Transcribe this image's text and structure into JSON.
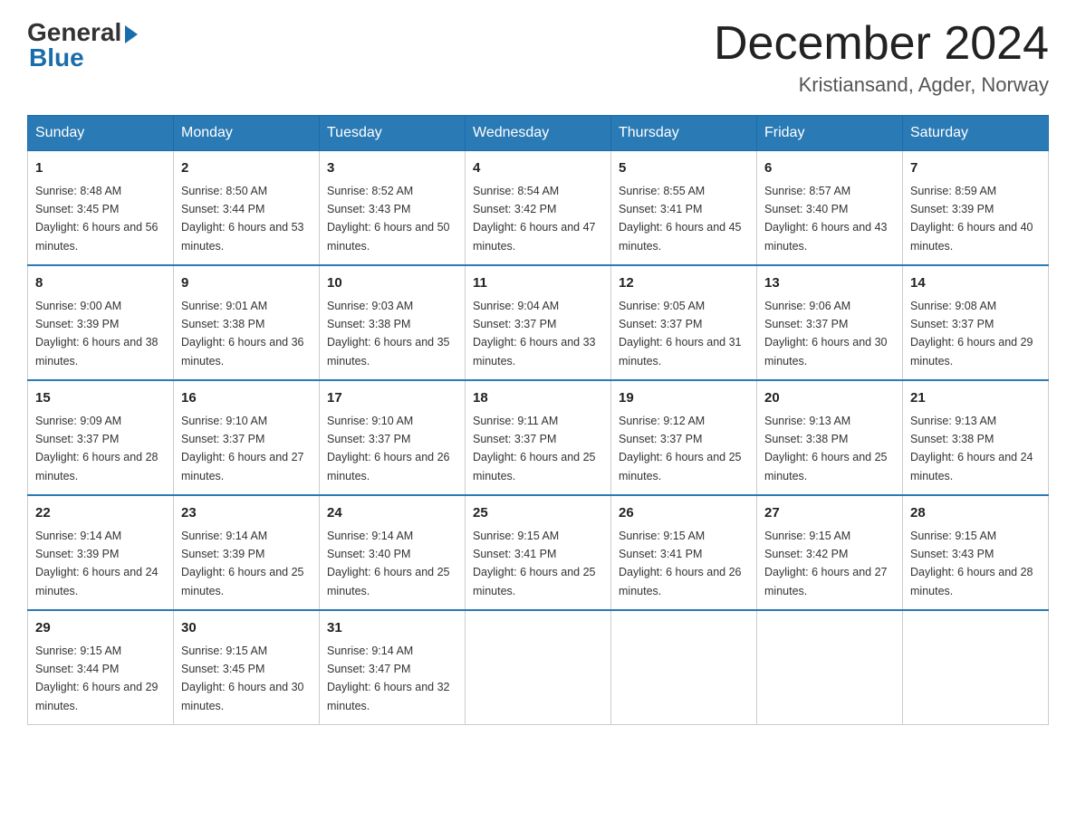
{
  "logo": {
    "general": "General",
    "blue": "Blue"
  },
  "title": "December 2024",
  "location": "Kristiansand, Agder, Norway",
  "days_of_week": [
    "Sunday",
    "Monday",
    "Tuesday",
    "Wednesday",
    "Thursday",
    "Friday",
    "Saturday"
  ],
  "weeks": [
    [
      {
        "day": "1",
        "sunrise": "8:48 AM",
        "sunset": "3:45 PM",
        "daylight": "6 hours and 56 minutes."
      },
      {
        "day": "2",
        "sunrise": "8:50 AM",
        "sunset": "3:44 PM",
        "daylight": "6 hours and 53 minutes."
      },
      {
        "day": "3",
        "sunrise": "8:52 AM",
        "sunset": "3:43 PM",
        "daylight": "6 hours and 50 minutes."
      },
      {
        "day": "4",
        "sunrise": "8:54 AM",
        "sunset": "3:42 PM",
        "daylight": "6 hours and 47 minutes."
      },
      {
        "day": "5",
        "sunrise": "8:55 AM",
        "sunset": "3:41 PM",
        "daylight": "6 hours and 45 minutes."
      },
      {
        "day": "6",
        "sunrise": "8:57 AM",
        "sunset": "3:40 PM",
        "daylight": "6 hours and 43 minutes."
      },
      {
        "day": "7",
        "sunrise": "8:59 AM",
        "sunset": "3:39 PM",
        "daylight": "6 hours and 40 minutes."
      }
    ],
    [
      {
        "day": "8",
        "sunrise": "9:00 AM",
        "sunset": "3:39 PM",
        "daylight": "6 hours and 38 minutes."
      },
      {
        "day": "9",
        "sunrise": "9:01 AM",
        "sunset": "3:38 PM",
        "daylight": "6 hours and 36 minutes."
      },
      {
        "day": "10",
        "sunrise": "9:03 AM",
        "sunset": "3:38 PM",
        "daylight": "6 hours and 35 minutes."
      },
      {
        "day": "11",
        "sunrise": "9:04 AM",
        "sunset": "3:37 PM",
        "daylight": "6 hours and 33 minutes."
      },
      {
        "day": "12",
        "sunrise": "9:05 AM",
        "sunset": "3:37 PM",
        "daylight": "6 hours and 31 minutes."
      },
      {
        "day": "13",
        "sunrise": "9:06 AM",
        "sunset": "3:37 PM",
        "daylight": "6 hours and 30 minutes."
      },
      {
        "day": "14",
        "sunrise": "9:08 AM",
        "sunset": "3:37 PM",
        "daylight": "6 hours and 29 minutes."
      }
    ],
    [
      {
        "day": "15",
        "sunrise": "9:09 AM",
        "sunset": "3:37 PM",
        "daylight": "6 hours and 28 minutes."
      },
      {
        "day": "16",
        "sunrise": "9:10 AM",
        "sunset": "3:37 PM",
        "daylight": "6 hours and 27 minutes."
      },
      {
        "day": "17",
        "sunrise": "9:10 AM",
        "sunset": "3:37 PM",
        "daylight": "6 hours and 26 minutes."
      },
      {
        "day": "18",
        "sunrise": "9:11 AM",
        "sunset": "3:37 PM",
        "daylight": "6 hours and 25 minutes."
      },
      {
        "day": "19",
        "sunrise": "9:12 AM",
        "sunset": "3:37 PM",
        "daylight": "6 hours and 25 minutes."
      },
      {
        "day": "20",
        "sunrise": "9:13 AM",
        "sunset": "3:38 PM",
        "daylight": "6 hours and 25 minutes."
      },
      {
        "day": "21",
        "sunrise": "9:13 AM",
        "sunset": "3:38 PM",
        "daylight": "6 hours and 24 minutes."
      }
    ],
    [
      {
        "day": "22",
        "sunrise": "9:14 AM",
        "sunset": "3:39 PM",
        "daylight": "6 hours and 24 minutes."
      },
      {
        "day": "23",
        "sunrise": "9:14 AM",
        "sunset": "3:39 PM",
        "daylight": "6 hours and 25 minutes."
      },
      {
        "day": "24",
        "sunrise": "9:14 AM",
        "sunset": "3:40 PM",
        "daylight": "6 hours and 25 minutes."
      },
      {
        "day": "25",
        "sunrise": "9:15 AM",
        "sunset": "3:41 PM",
        "daylight": "6 hours and 25 minutes."
      },
      {
        "day": "26",
        "sunrise": "9:15 AM",
        "sunset": "3:41 PM",
        "daylight": "6 hours and 26 minutes."
      },
      {
        "day": "27",
        "sunrise": "9:15 AM",
        "sunset": "3:42 PM",
        "daylight": "6 hours and 27 minutes."
      },
      {
        "day": "28",
        "sunrise": "9:15 AM",
        "sunset": "3:43 PM",
        "daylight": "6 hours and 28 minutes."
      }
    ],
    [
      {
        "day": "29",
        "sunrise": "9:15 AM",
        "sunset": "3:44 PM",
        "daylight": "6 hours and 29 minutes."
      },
      {
        "day": "30",
        "sunrise": "9:15 AM",
        "sunset": "3:45 PM",
        "daylight": "6 hours and 30 minutes."
      },
      {
        "day": "31",
        "sunrise": "9:14 AM",
        "sunset": "3:47 PM",
        "daylight": "6 hours and 32 minutes."
      },
      null,
      null,
      null,
      null
    ]
  ]
}
